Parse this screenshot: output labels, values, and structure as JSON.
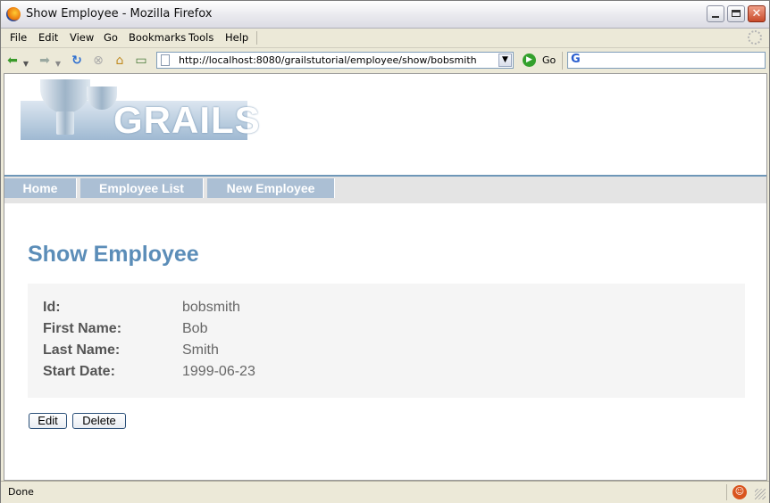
{
  "window": {
    "title": "Show Employee - Mozilla Firefox"
  },
  "menubar": {
    "items": [
      "File",
      "Edit",
      "View",
      "Go",
      "Bookmarks",
      "Tools",
      "Help"
    ]
  },
  "toolbar": {
    "url": "http://localhost:8080/grailstutorial/employee/show/bobsmith",
    "go_label": "Go"
  },
  "logo": {
    "text": "GRAILS"
  },
  "nav": {
    "links": [
      "Home",
      "Employee List",
      "New Employee"
    ]
  },
  "main": {
    "title": "Show Employee",
    "fields": [
      {
        "label": "Id:",
        "value": "bobsmith"
      },
      {
        "label": "First Name:",
        "value": "Bob"
      },
      {
        "label": "Last Name:",
        "value": "Smith"
      },
      {
        "label": "Start Date:",
        "value": "1999-06-23"
      }
    ],
    "buttons": {
      "edit": "Edit",
      "delete": "Delete"
    }
  },
  "status": {
    "text": "Done"
  },
  "colors": {
    "accent": "#5b8db8",
    "nav_link_bg": "#abbfd4",
    "detail_bg": "#f5f5f5"
  }
}
